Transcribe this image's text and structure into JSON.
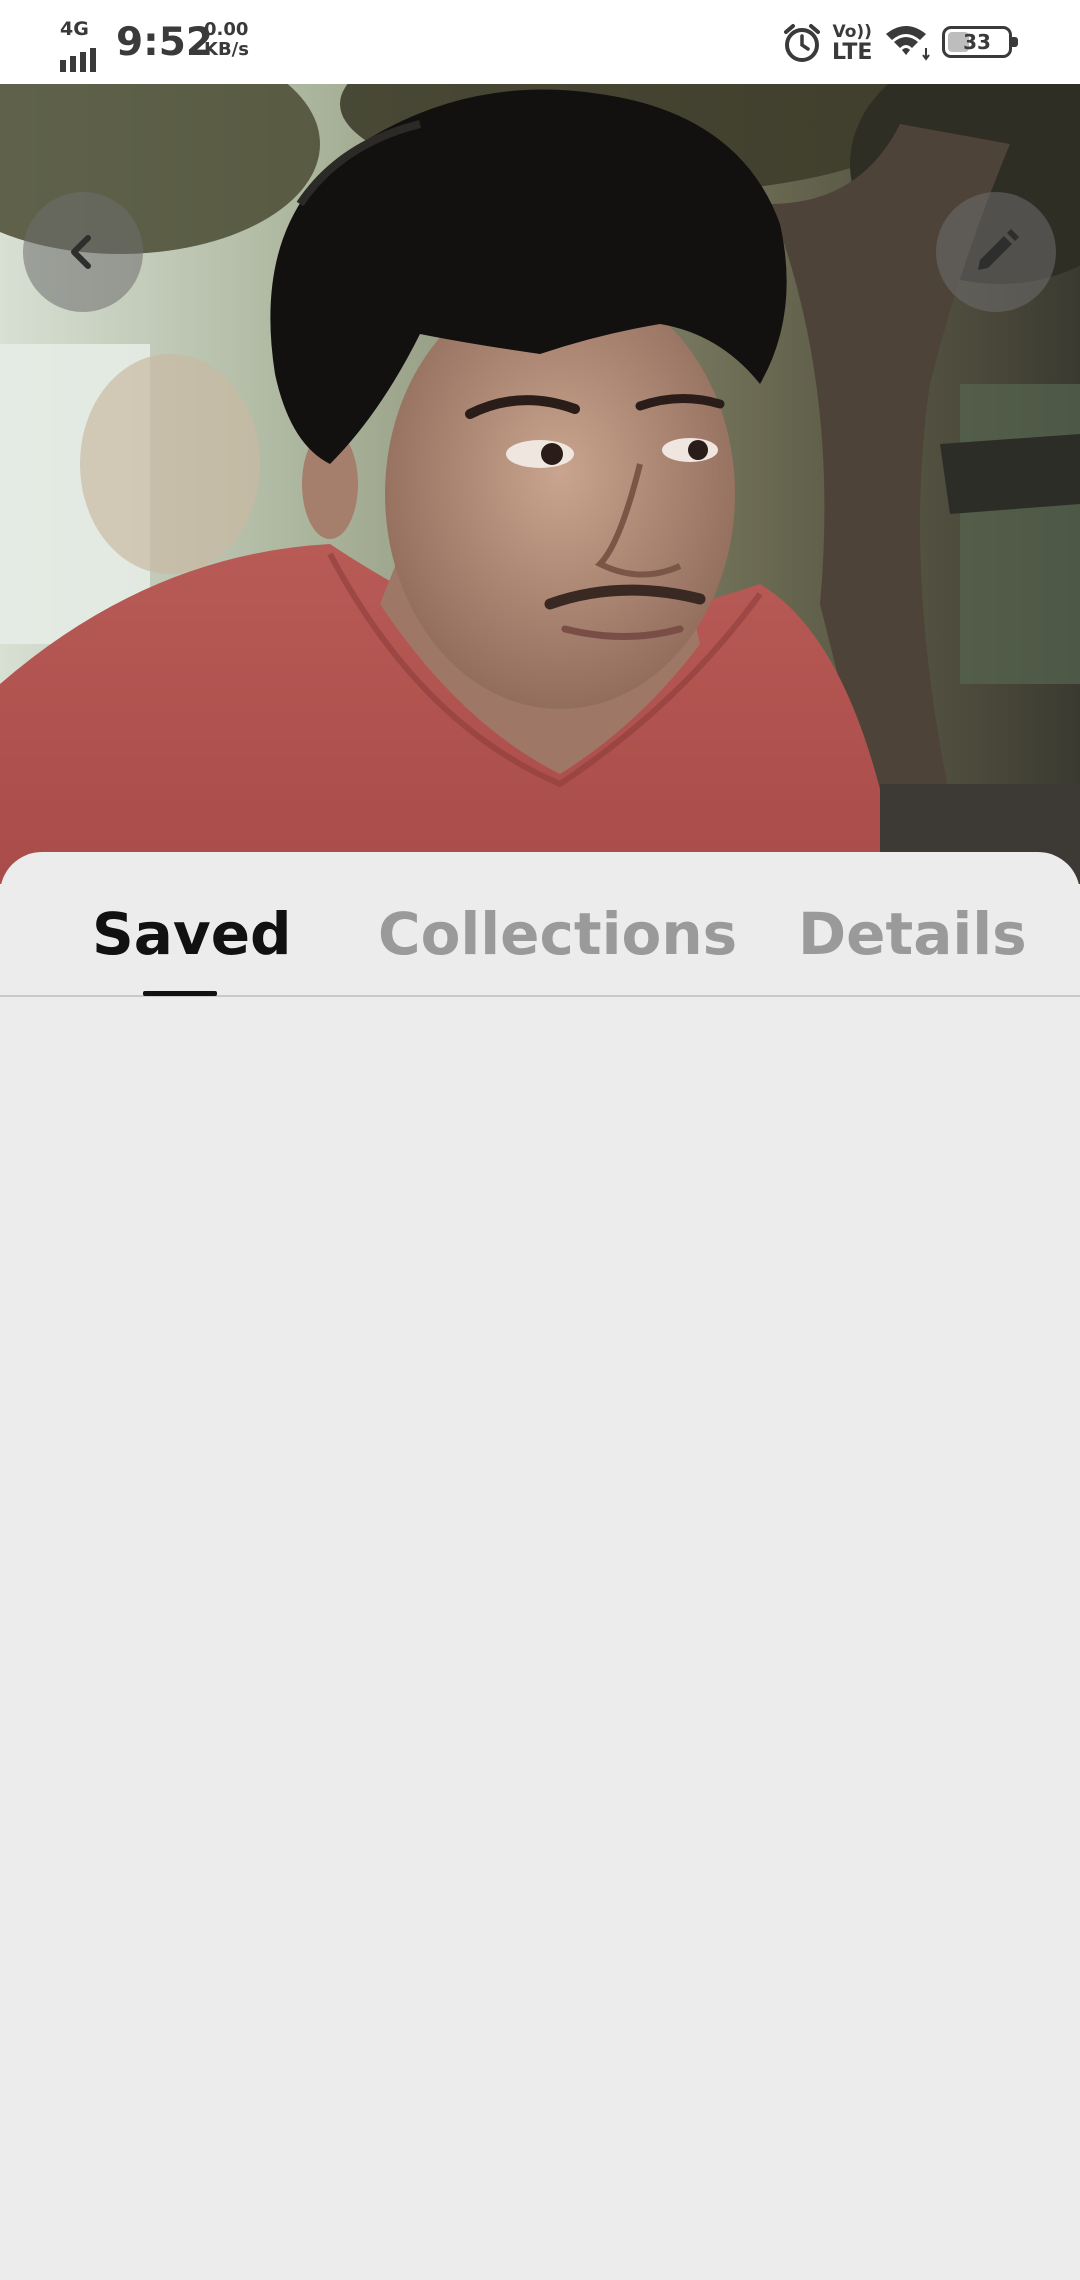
{
  "status_bar": {
    "network_type": "4G",
    "time": "9:52",
    "speed_value": "0.00",
    "speed_unit": "KB/s",
    "volte_top": "Vo))",
    "volte_bottom": "LTE",
    "battery_level": "33",
    "icons": [
      "signal-icon",
      "alarm-icon",
      "wifi-icon",
      "battery-icon"
    ]
  },
  "header": {
    "back_icon": "chevron-left-icon",
    "edit_icon": "pencil-icon",
    "photo": "profile-photo"
  },
  "tabs": {
    "items": [
      {
        "label": "Saved",
        "active": true
      },
      {
        "label": "Collections",
        "active": false
      },
      {
        "label": "Details",
        "active": false
      }
    ]
  },
  "colors": {
    "active_tab": "#111111",
    "inactive_tab": "#9a9a9a",
    "sheet_background": "#ececec"
  }
}
